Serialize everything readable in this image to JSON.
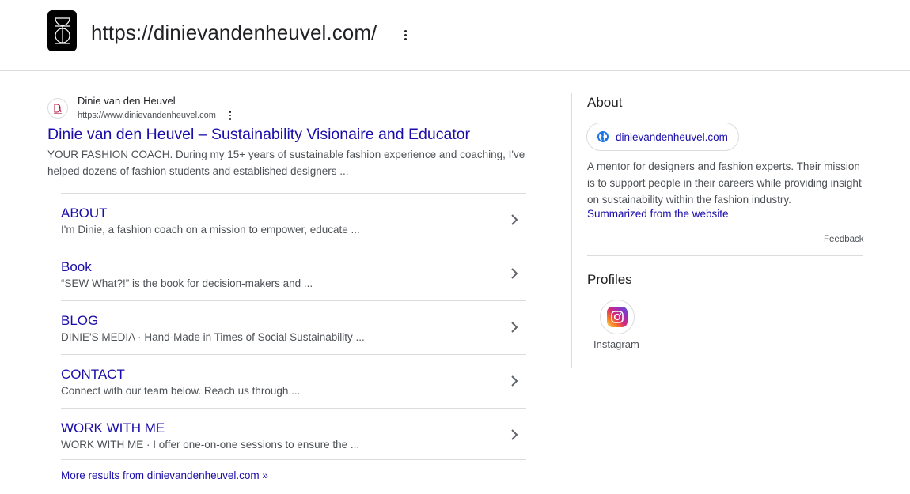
{
  "header": {
    "url": "https://dinievandenheuvel.com/",
    "logo_icon": "site-logo-icon",
    "menu_icon": "more-vert-icon"
  },
  "result": {
    "site_name": "Dinie van den Heuvel",
    "cite": "https://www.dinievandenheuvel.com",
    "favicon_icon": "site-favicon-icon",
    "title": "Dinie van den Heuvel – Sustainability Visionaire and Educator",
    "snippet": "YOUR FASHION COACH. During my 15+ years of sustainable fashion experience and coaching, I've helped dozens of fashion students and established designers ..."
  },
  "sitelinks": [
    {
      "title": "ABOUT",
      "description": "I'm Dinie, a fashion coach on a mission to empower, educate ..."
    },
    {
      "title": "Book",
      "description": "“SEW What?!” is the book for decision-makers and ..."
    },
    {
      "title": "BLOG",
      "description": "DINIE'S MEDIA · Hand-Made in Times of Social Sustainability ..."
    },
    {
      "title": "CONTACT",
      "description": "Connect with our team below. Reach us through ..."
    },
    {
      "title": "WORK WITH ME",
      "description": "WORK WITH ME · I offer one-on-one sessions to ensure the ..."
    }
  ],
  "more_results": "More results from dinievandenheuvel.com »",
  "about": {
    "heading": "About",
    "chip_label": "dinievandenheuvel.com",
    "chip_icon": "globe-icon",
    "description": "A mentor for designers and fashion experts. Their mission is to support people in their careers while providing insight on sustainability within the fashion industry.",
    "summarized": "Summarized from the website",
    "feedback": "Feedback"
  },
  "profiles": {
    "heading": "Profiles",
    "items": [
      {
        "label": "Instagram",
        "icon": "instagram-icon"
      }
    ]
  },
  "colors": {
    "link": "#1a0dab",
    "text": "#202124",
    "muted": "#4d5156",
    "border": "#dadce0"
  }
}
